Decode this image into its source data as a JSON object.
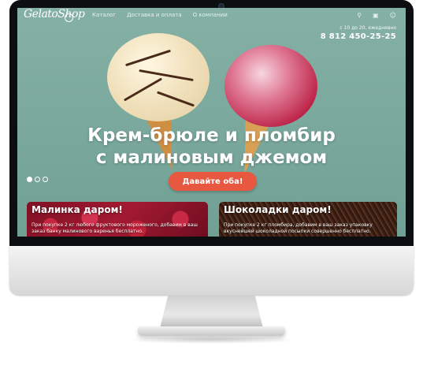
{
  "header": {
    "logo_text": "GelatoShop",
    "nav": [
      "Каталог",
      "Доставка и оплата",
      "О компании"
    ],
    "icons": [
      "search-icon",
      "cart-icon",
      "user-icon"
    ],
    "hours": "с 10 до 20, ежедневно",
    "phone": "8 812 450-25-25"
  },
  "hero": {
    "title_line1": "Крем-брюле и пломбир",
    "title_line2": "с малиновым джемом",
    "cta_label": "Давайте оба!",
    "slides_total": 3,
    "slide_active": 1
  },
  "promos": [
    {
      "title": "Малинка даром!",
      "text": "При покупке 2 кг любого фруктового мороженого, добавим в ваш заказ банку малинового варенья бесплатно."
    },
    {
      "title": "Шоколадки даром!",
      "text": "При покупке 2 кг пломбира, добавим в ваш заказ упаковку вкуснейшей шоколадной посыпки совершенно бесплатно."
    }
  ],
  "colors": {
    "background": "#7aa89c",
    "cta": "#e8573f"
  }
}
